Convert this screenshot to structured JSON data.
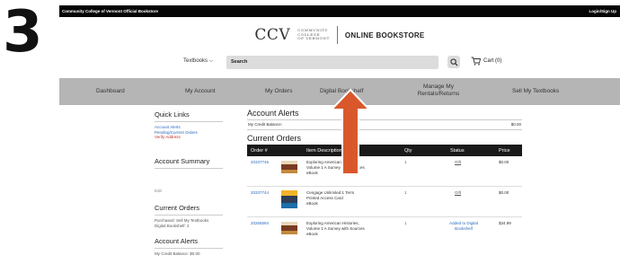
{
  "step_number": "3",
  "topbar": {
    "left": "Community College of Vermont Official Bookstore",
    "right": "Login/Sign Up"
  },
  "brand": {
    "logo": "CCV",
    "sub1": "COMMUNITY",
    "sub2": "COLLEGE",
    "sub3": "OF VERMONT",
    "store": "ONLINE BOOKSTORE"
  },
  "search": {
    "textbooks_label": "Textbooks",
    "placeholder": "Search",
    "cart": "Cart (0)"
  },
  "nav": [
    "Dashboard",
    "My Account",
    "My Orders",
    "Digital Bookshelf",
    "Manage My",
    "Rentals/Returns",
    "Sell My Textbooks"
  ],
  "left": {
    "quick_links_title": "Quick Links",
    "quick_links": [
      "Account Alerts",
      "Pending/Current Orders",
      "Verify Address"
    ],
    "account_summary_title": "Account Summary",
    "edit": "Edit",
    "current_orders_title": "Current Orders",
    "current_orders_lines": [
      "Purchased: Sell My Textbooks",
      "Digital Bookshelf: 2"
    ],
    "account_alerts_title": "Account Alerts",
    "account_alerts_line": "My Credit Balance: $0.00"
  },
  "main": {
    "alerts_title": "Account Alerts",
    "credit_label": "My Credit Balance:",
    "credit_value": "$0.00",
    "orders_title": "Current Orders",
    "columns": [
      "Order #",
      "Item Description",
      "Qty",
      "Status",
      "Price"
    ],
    "rows": [
      {
        "order": "20337745",
        "desc": [
          "Exploring American Histories,",
          "Volume 1 A Survey with Sources",
          "eBook"
        ],
        "qty": "1",
        "status": [
          "Gift"
        ],
        "price": "$0.00"
      },
      {
        "order": "20337744",
        "desc": [
          "Cengage Unlimited 1 Term",
          "Printed Access Card",
          "eBook"
        ],
        "qty": "1",
        "status": [
          "Gift"
        ],
        "price": "$0.00"
      },
      {
        "order": "20265594",
        "desc": [
          "Exploring American Histories,",
          "Volume 1 A Survey with Sources",
          "eBook"
        ],
        "qty": "1",
        "status": [
          "Added to Digital",
          "Bookshelf"
        ],
        "price": "$34.99"
      }
    ]
  },
  "colors": {
    "nav_bg": "#b5b5b5",
    "arrow": "#d9582b",
    "link": "#2a6bbd",
    "alert_link": "#c4342d"
  }
}
